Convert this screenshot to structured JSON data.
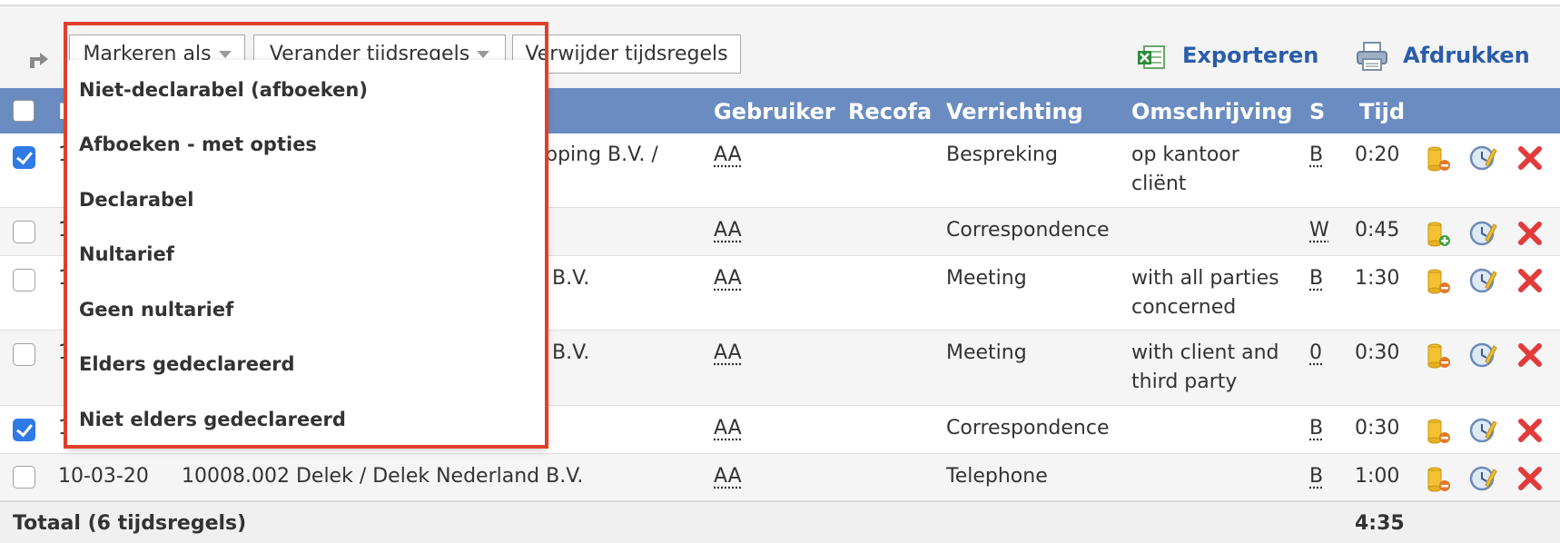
{
  "toolbar": {
    "markeren_label": "Markeren als",
    "verander_label": "Verander tijdsregels",
    "verwijder_label": "Verwijder tijdsregels",
    "export_label": "Exporteren",
    "print_label": "Afdrukken",
    "icons": [
      "arrow-right-icon",
      "excel-icon",
      "printer-icon"
    ]
  },
  "menu": {
    "items": [
      "Niet-declarabel (afboeken)",
      "Afboeken - met opties",
      "Declarabel",
      "Nultarief",
      "Geen nultarief",
      "Elders gedeclareerd",
      "Niet elders gedeclareerd"
    ]
  },
  "table": {
    "headers": {
      "first": "D",
      "gebruiker": "Gebruiker",
      "recofa": "Recofa",
      "verrichting": "Verrichting",
      "omschrijving": "Omschrijving",
      "s": "S",
      "tijd": "Tijd"
    },
    "rows": [
      {
        "checked": true,
        "date": "1",
        "dossier": "ipping B.V. /",
        "gebruiker": "AA",
        "verrichting": "Bespreking",
        "omschrijving_1": "op kantoor",
        "omschrijving_2": "cliënt",
        "s": "B",
        "tijd": "0:20",
        "row_icons": [
          "coins-remove-icon",
          "clock-edit-icon",
          "delete-icon"
        ]
      },
      {
        "checked": false,
        "date": "1",
        "dossier": "",
        "gebruiker": "AA",
        "verrichting": "Correspondence",
        "omschrijving_1": "",
        "omschrijving_2": "",
        "s": "W",
        "tijd": "0:45",
        "row_icons": [
          "coins-add-icon",
          "clock-edit-icon",
          "delete-icon"
        ]
      },
      {
        "checked": false,
        "date": "1",
        "dossier": "B.V.",
        "gebruiker": "AA",
        "verrichting": "Meeting",
        "omschrijving_1": "with all parties",
        "omschrijving_2": "concerned",
        "s": "B",
        "tijd": "1:30",
        "row_icons": [
          "coins-remove-icon",
          "clock-edit-icon",
          "delete-icon"
        ]
      },
      {
        "checked": false,
        "date": "1",
        "dossier": "B.V.",
        "gebruiker": "AA",
        "verrichting": "Meeting",
        "omschrijving_1": "with client and",
        "omschrijving_2": "third party",
        "s": "0",
        "tijd": "0:30",
        "row_icons": [
          "coins-remove-icon",
          "clock-edit-icon",
          "delete-icon"
        ]
      },
      {
        "checked": true,
        "date": "1",
        "dossier": "",
        "gebruiker": "AA",
        "verrichting": "Correspondence",
        "omschrijving_1": "",
        "omschrijving_2": "",
        "s": "B",
        "tijd": "0:30",
        "row_icons": [
          "coins-remove-icon",
          "clock-edit-icon",
          "delete-icon"
        ]
      },
      {
        "checked": false,
        "date": "10-03-20",
        "dossier": "10008.002 Delek / Delek Nederland B.V.",
        "gebruiker": "AA",
        "verrichting": "Telephone",
        "omschrijving_1": "",
        "omschrijving_2": "",
        "s": "B",
        "tijd": "1:00",
        "row_icons": [
          "coins-remove-icon",
          "clock-edit-icon",
          "delete-icon"
        ]
      }
    ],
    "total_label": "Totaal (6 tijdsregels)",
    "total_time": "4:35"
  },
  "colors": {
    "header_bg": "#6a8cc1",
    "link": "#2a5caa",
    "highlight": "#e0402b",
    "checkbox_on": "#2f7ae5",
    "delete": "#e23b3b"
  }
}
